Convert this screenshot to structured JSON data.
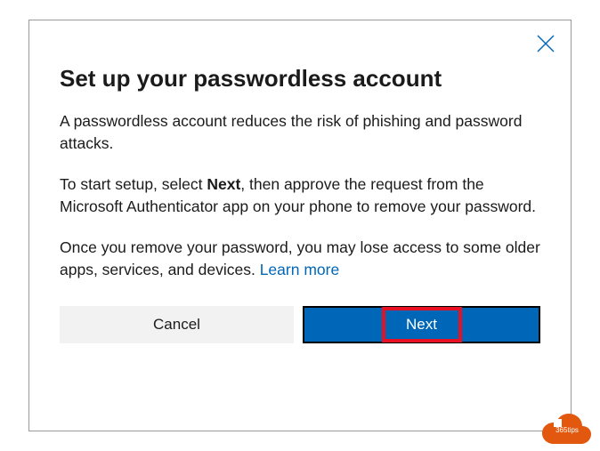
{
  "dialog": {
    "title": "Set up your passwordless account",
    "paragraph1": "A passwordless account reduces the risk of phishing and password attacks.",
    "paragraph2_prefix": "To start setup, select ",
    "paragraph2_bold": "Next",
    "paragraph2_suffix": ", then approve the request from the Microsoft Authenticator app on your phone to remove your password.",
    "paragraph3_text": "Once you remove your password, you may lose access to some older apps, services, and devices. ",
    "learn_more": "Learn more",
    "cancel_label": "Cancel",
    "next_label": "Next"
  },
  "badge": {
    "text": "365tips"
  }
}
